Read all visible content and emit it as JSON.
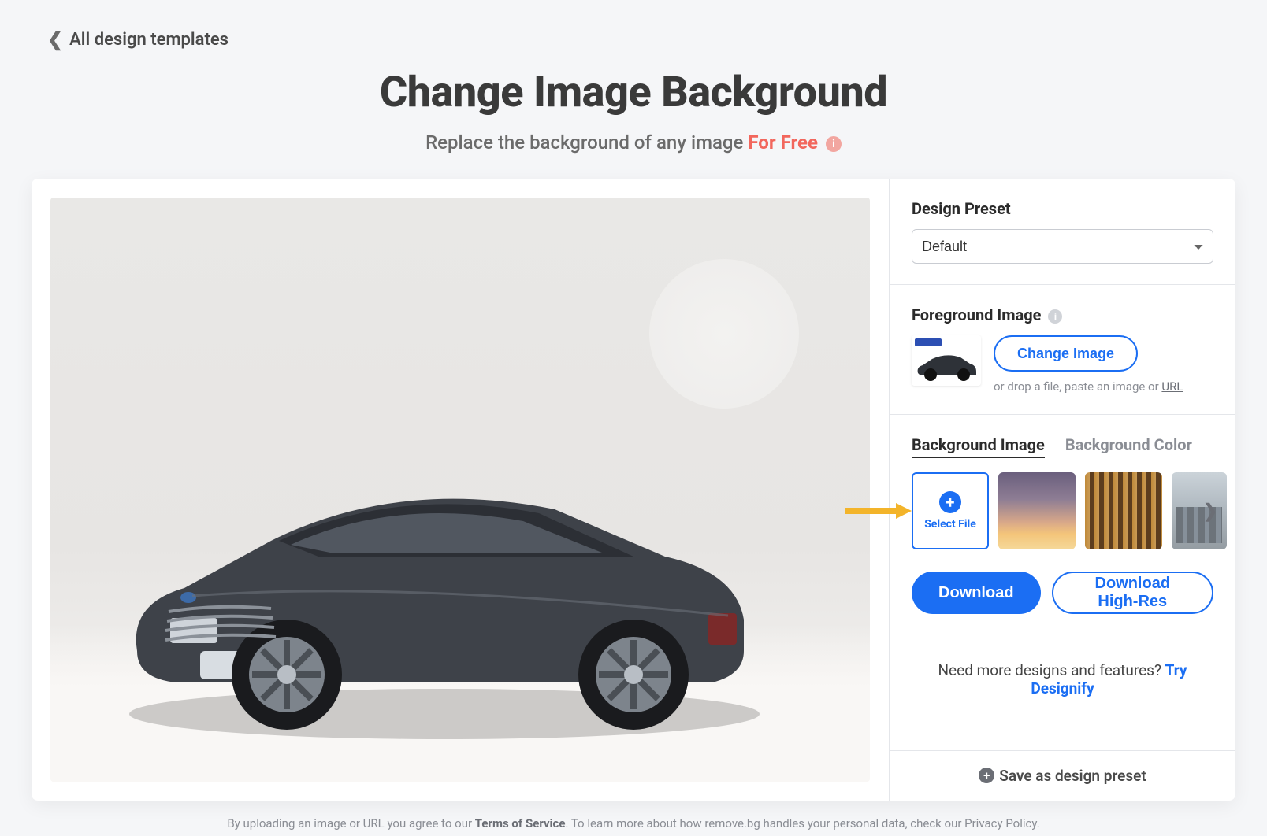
{
  "breadcrumb": {
    "label": "All design templates"
  },
  "header": {
    "title": "Change Image Background",
    "subtitle_lead": "Replace the background of any image",
    "subtitle_free": "For Free"
  },
  "preset": {
    "label": "Design Preset",
    "selected": "Default"
  },
  "foreground": {
    "label": "Foreground Image",
    "change_btn": "Change Image",
    "drop_hint_lead": "or drop a file, paste an image or ",
    "drop_hint_url": "URL"
  },
  "background": {
    "tabs": {
      "image": "Background Image",
      "color": "Background Color"
    },
    "select_file": "Select File"
  },
  "actions": {
    "download": "Download",
    "download_hires": "Download High-Res"
  },
  "promo": {
    "lead": "Need more designs and features? ",
    "link": "Try Designify"
  },
  "save_preset": {
    "label": "Save as design preset"
  },
  "footer": {
    "lead": "By uploading an image or URL you agree to our ",
    "tos": "Terms of Service",
    "tail": ". To learn more about how remove.bg handles your personal data, check our Privacy Policy."
  }
}
